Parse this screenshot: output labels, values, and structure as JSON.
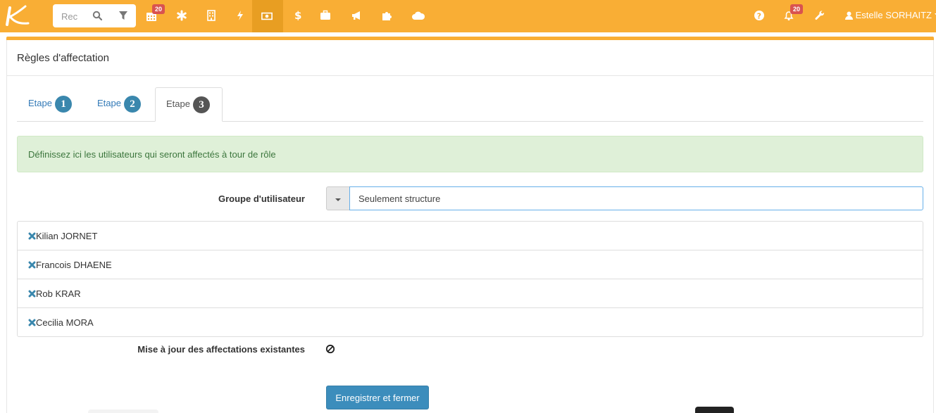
{
  "topbar": {
    "search_placeholder": "Rec",
    "calendar_badge": "20",
    "notifications_badge": "20",
    "user_name": "Estelle SORHAITZ",
    "colors": {
      "bar": "#f9ae35",
      "active": "#e89e22",
      "badge": "#d9534f"
    },
    "icons": [
      "search-icon",
      "filter-icon",
      "calendar-icon",
      "asterisk-icon",
      "building-icon",
      "bolt-icon",
      "money-icon",
      "dollar-icon",
      "briefcase-icon",
      "bullhorn-icon",
      "puzzle-icon",
      "cloud-icon",
      "question-icon",
      "bell-icon",
      "wrench-icon",
      "user-icon",
      "caret-down-icon"
    ]
  },
  "panel": {
    "title": "Règles d'affectation"
  },
  "tabs": [
    {
      "label": "Etape",
      "number": "1"
    },
    {
      "label": "Etape",
      "number": "2"
    },
    {
      "label": "Etape",
      "number": "3"
    }
  ],
  "alert": {
    "text": "Définissez ici les utilisateurs qui seront affectés à tour de rôle"
  },
  "form": {
    "group_label": "Groupe d'utilisateur",
    "group_value": "Seulement structure",
    "users": [
      "Kilian JORNET",
      "Francois DHAENE",
      "Rob KRAR",
      "Cecilia MORA"
    ],
    "update_label": "Mise à jour des affectations existantes",
    "save_label": "Enregistrer et fermer"
  }
}
